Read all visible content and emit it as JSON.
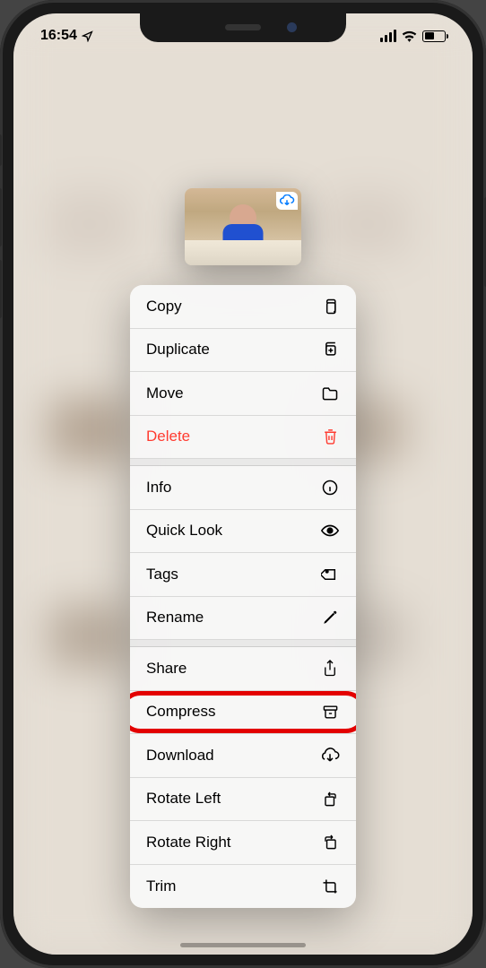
{
  "status": {
    "time": "16:54",
    "location_active": true,
    "battery_pct": 50
  },
  "nav": {
    "back_hint": "",
    "title_hint": ""
  },
  "thumbnail": {
    "has_cloud_badge": true
  },
  "menu": {
    "groups": [
      [
        {
          "key": "copy",
          "label": "Copy",
          "icon": "copy-icon",
          "destructive": false
        },
        {
          "key": "duplicate",
          "label": "Duplicate",
          "icon": "duplicate-icon",
          "destructive": false
        },
        {
          "key": "move",
          "label": "Move",
          "icon": "folder-icon",
          "destructive": false
        },
        {
          "key": "delete",
          "label": "Delete",
          "icon": "trash-icon",
          "destructive": true
        }
      ],
      [
        {
          "key": "info",
          "label": "Info",
          "icon": "info-icon",
          "destructive": false
        },
        {
          "key": "quicklook",
          "label": "Quick Look",
          "icon": "eye-icon",
          "destructive": false
        },
        {
          "key": "tags",
          "label": "Tags",
          "icon": "tag-icon",
          "destructive": false
        },
        {
          "key": "rename",
          "label": "Rename",
          "icon": "pencil-icon",
          "destructive": false
        }
      ],
      [
        {
          "key": "share",
          "label": "Share",
          "icon": "share-icon",
          "destructive": false
        },
        {
          "key": "compress",
          "label": "Compress",
          "icon": "archive-icon",
          "destructive": false,
          "highlighted": true
        },
        {
          "key": "download",
          "label": "Download",
          "icon": "download-cloud-icon",
          "destructive": false
        },
        {
          "key": "rotateleft",
          "label": "Rotate Left",
          "icon": "rotate-left-icon",
          "destructive": false
        },
        {
          "key": "rotateright",
          "label": "Rotate Right",
          "icon": "rotate-right-icon",
          "destructive": false
        },
        {
          "key": "trim",
          "label": "Trim",
          "icon": "crop-icon",
          "destructive": false
        }
      ]
    ]
  }
}
